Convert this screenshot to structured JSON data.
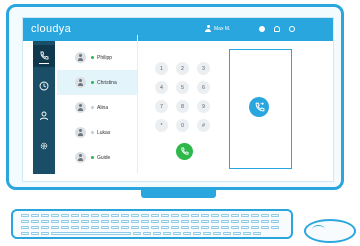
{
  "app": {
    "logo": "cloudya",
    "user_name": "Max M."
  },
  "colors": {
    "brand": "#2aa6de",
    "sidebar": "#1a4d66",
    "online": "#2eb84a",
    "offline": "#c8cdd1",
    "call": "#2eb84a"
  },
  "sidebar": {
    "items": [
      {
        "icon": "phone-icon",
        "active": true
      },
      {
        "icon": "clock-icon",
        "active": false
      },
      {
        "icon": "person-icon",
        "active": false
      },
      {
        "icon": "gear-icon",
        "active": false
      }
    ]
  },
  "contacts": [
    {
      "name": "Philipp",
      "status": "online",
      "selected": false
    },
    {
      "name": "Christina",
      "status": "online",
      "selected": true
    },
    {
      "name": "Alina",
      "status": "offline",
      "selected": false
    },
    {
      "name": "Lukas",
      "status": "offline",
      "selected": false
    },
    {
      "name": "Guide",
      "status": "online",
      "selected": false
    }
  ],
  "keypad": {
    "keys": [
      "1",
      "2",
      "3",
      "4",
      "5",
      "6",
      "7",
      "8",
      "9",
      "*",
      "0",
      "#"
    ]
  },
  "icons": {
    "call": "phone-call-icon",
    "transfer": "phone-forward-icon"
  }
}
